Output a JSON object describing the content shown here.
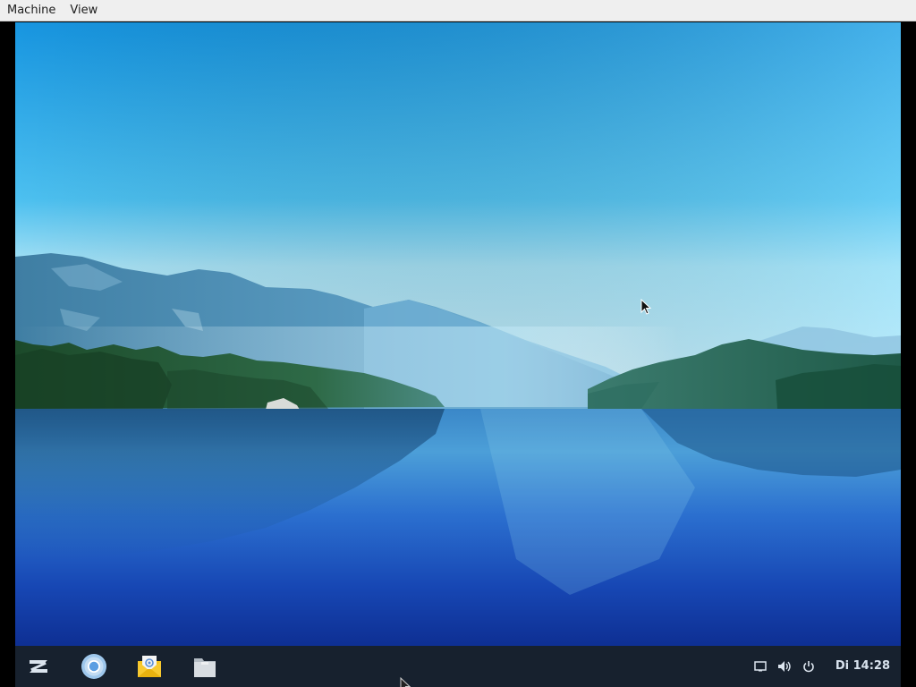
{
  "menubar": {
    "items": [
      {
        "label": "Machine"
      },
      {
        "label": "View"
      }
    ]
  },
  "taskbar": {
    "launchers": [
      {
        "name": "zorin-menu-icon"
      },
      {
        "name": "chromium-browser-icon"
      },
      {
        "name": "mail-client-icon"
      },
      {
        "name": "files-folder-icon"
      }
    ],
    "tray": [
      {
        "name": "notifications-icon"
      },
      {
        "name": "volume-icon"
      },
      {
        "name": "power-icon"
      }
    ],
    "clock": "Di 14:28"
  },
  "colors": {
    "sky_top": "#1a9fe6",
    "sky_horizon": "#aee6f7",
    "water_deep": "#0d2a8a",
    "taskbar": "#17212e"
  }
}
